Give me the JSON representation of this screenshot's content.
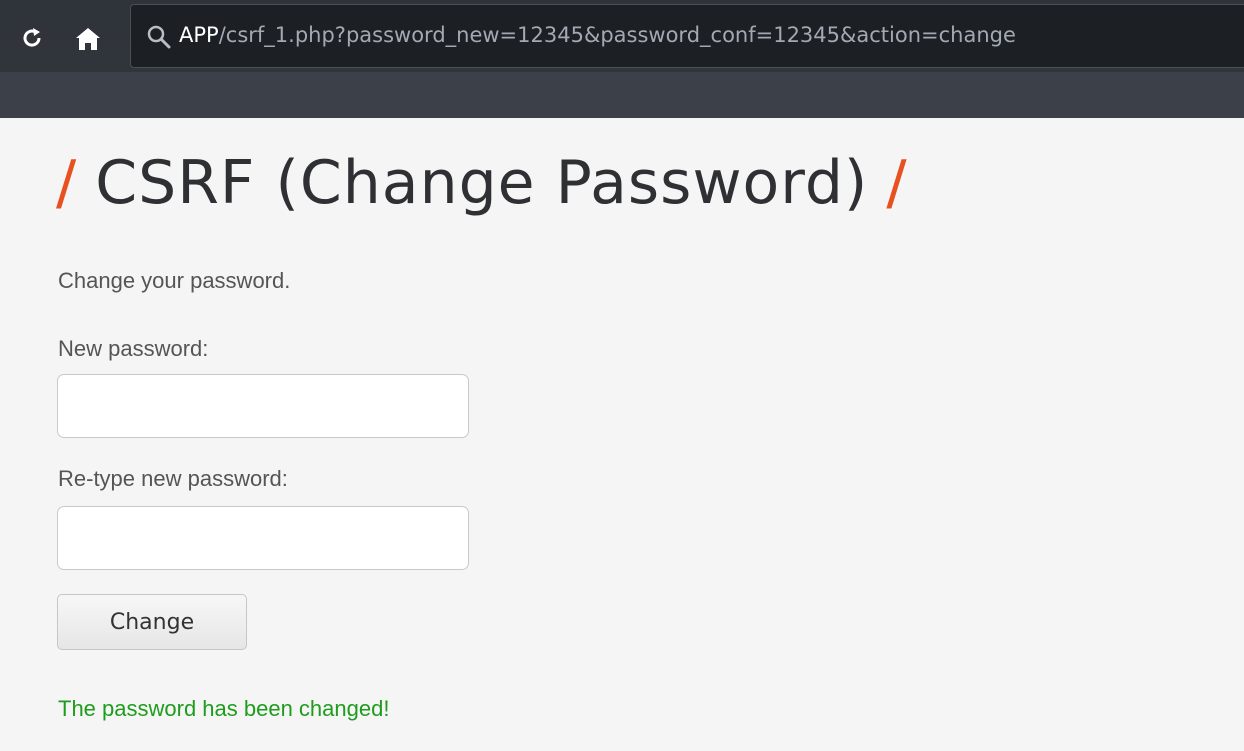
{
  "browser": {
    "url_host": "APP",
    "url_path": "/csrf_1.php?password_new=12345&password_conf=12345&action=change",
    "reload_icon": "reload-icon",
    "home_icon": "home-icon",
    "search_icon": "search-icon"
  },
  "page": {
    "title_slash_left": "/",
    "title": "CSRF (Change Password)",
    "title_slash_right": "/",
    "intro": "Change your password.",
    "new_password_label": "New password:",
    "new_password_value": "",
    "retype_password_label": "Re-type new password:",
    "retype_password_value": "",
    "change_button": "Change",
    "success_message": "The password has been changed!"
  },
  "colors": {
    "accent_slash": "#e8511f",
    "success": "#1e9c1e",
    "browser_bar": "#2f333a"
  }
}
